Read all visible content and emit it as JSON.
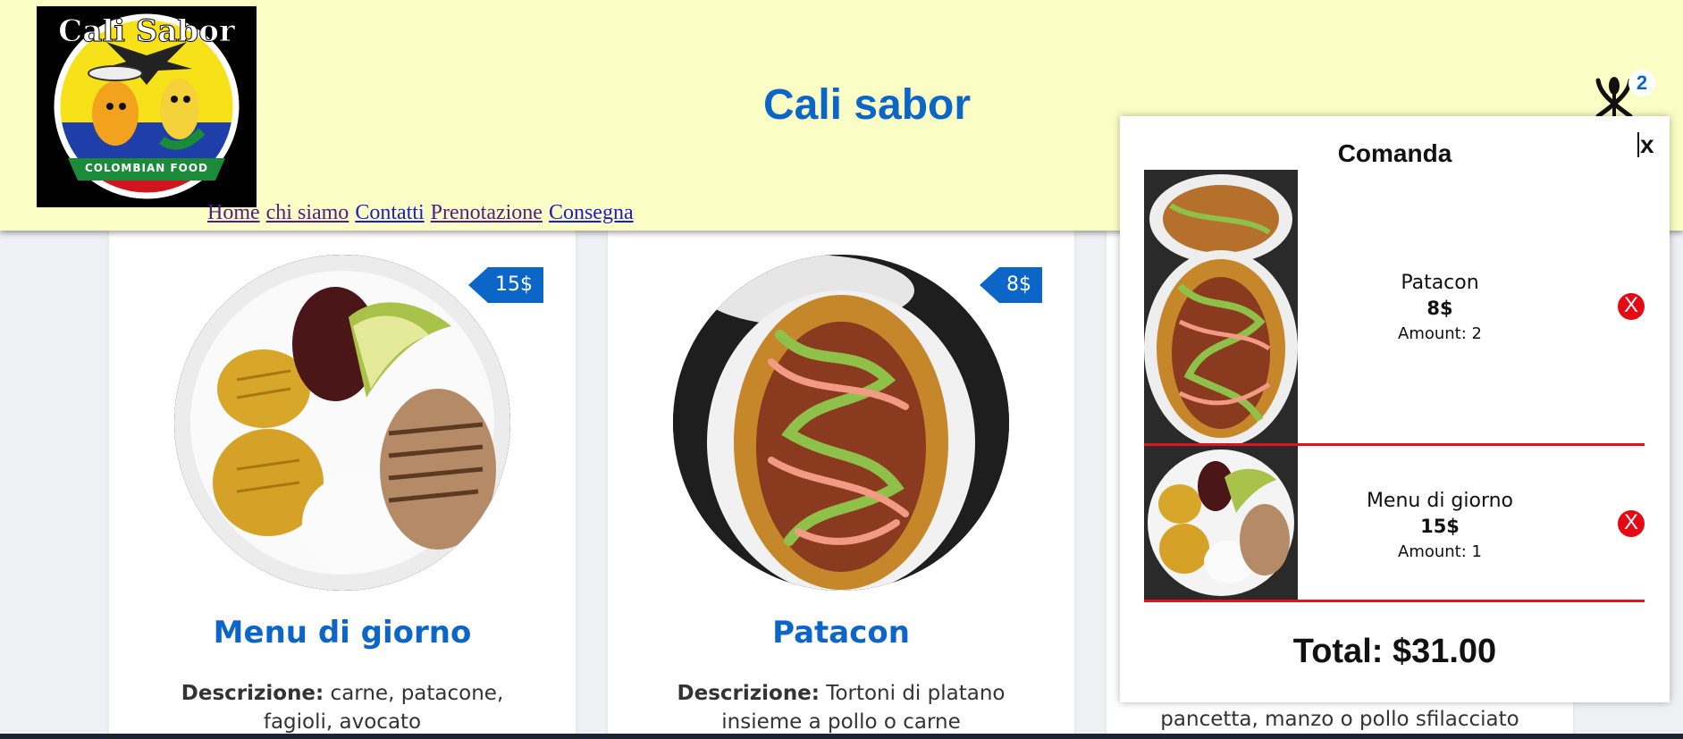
{
  "header": {
    "logo": {
      "arc_text": "Cali Sabor",
      "banner_text": "COLOMBIAN FOOD"
    },
    "title": "Cali sabor",
    "nav": [
      "Home",
      "chi siamo",
      "Contatti",
      "Prenotazione",
      "Consegna"
    ],
    "cart": {
      "icon": "cutlery-icon",
      "count": "2"
    }
  },
  "menu": {
    "desc_label": "Descrizione:",
    "items": [
      {
        "name": "Menu di giorno",
        "price": "15$",
        "description": "carne, patacone, fagioli, avocato"
      },
      {
        "name": "Patacon",
        "price": "8$",
        "description": "Tortoni di platano insieme a pollo o carne"
      },
      {
        "description_visible": "pancetta, manzo o pollo sfilacciato"
      }
    ]
  },
  "order_panel": {
    "title": "Comanda",
    "close_label": "x",
    "items": [
      {
        "name": "Patacon",
        "price": "8$",
        "amount": "Amount: 2",
        "remove_label": "X"
      },
      {
        "name": "Menu di giorno",
        "price": "15$",
        "amount": "Amount: 1",
        "remove_label": "X"
      }
    ],
    "total": "Total: $31.00"
  },
  "colors": {
    "header_bg": "#fbfec4",
    "accent": "#0b66c8",
    "remove": "#e50914",
    "divider": "#e0141b"
  }
}
